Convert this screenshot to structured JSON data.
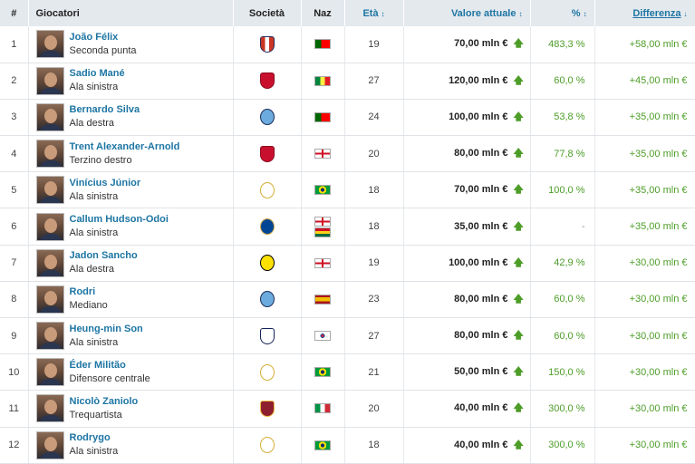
{
  "headers": {
    "rank": "#",
    "players": "Giocatori",
    "club": "Società",
    "nat": "Naz",
    "age": "Età",
    "value": "Valore attuale",
    "pct": "%",
    "diff": "Differenza"
  },
  "sort_icons": {
    "neutral": "↕",
    "active": "↓"
  },
  "arrow_glyph": "🡅",
  "colors": {
    "header_bg": "#e4e9ee",
    "link": "#1d75a3",
    "positive": "#4d9d28"
  },
  "rows": [
    {
      "rank": "1",
      "name": "João Félix",
      "position": "Seconda punta",
      "club": "atletico-madrid-crest",
      "flags": [
        "portugal-flag"
      ],
      "age": "19",
      "value": "70,00 mln €",
      "pct": "483,3 %",
      "diff": "+58,00 mln €"
    },
    {
      "rank": "2",
      "name": "Sadio Mané",
      "position": "Ala sinistra",
      "club": "liverpool-crest",
      "flags": [
        "senegal-flag"
      ],
      "age": "27",
      "value": "120,00 mln €",
      "pct": "60,0 %",
      "diff": "+45,00 mln €"
    },
    {
      "rank": "3",
      "name": "Bernardo Silva",
      "position": "Ala destra",
      "club": "manchester-city-crest",
      "flags": [
        "portugal-flag"
      ],
      "age": "24",
      "value": "100,00 mln €",
      "pct": "53,8 %",
      "diff": "+35,00 mln €"
    },
    {
      "rank": "4",
      "name": "Trent Alexander-Arnold",
      "position": "Terzino destro",
      "club": "liverpool-crest",
      "flags": [
        "england-flag"
      ],
      "age": "20",
      "value": "80,00 mln €",
      "pct": "77,8 %",
      "diff": "+35,00 mln €"
    },
    {
      "rank": "5",
      "name": "Vinícius Júnior",
      "position": "Ala sinistra",
      "club": "real-madrid-crest",
      "flags": [
        "brazil-flag"
      ],
      "age": "18",
      "value": "70,00 mln €",
      "pct": "100,0 %",
      "diff": "+35,00 mln €"
    },
    {
      "rank": "6",
      "name": "Callum Hudson-Odoi",
      "position": "Ala sinistra",
      "club": "chelsea-crest",
      "flags": [
        "england-flag",
        "ghana-flag"
      ],
      "age": "18",
      "value": "35,00 mln €",
      "pct": "-",
      "diff": "+35,00 mln €"
    },
    {
      "rank": "7",
      "name": "Jadon Sancho",
      "position": "Ala destra",
      "club": "borussia-dortmund-crest",
      "flags": [
        "england-flag"
      ],
      "age": "19",
      "value": "100,00 mln €",
      "pct": "42,9 %",
      "diff": "+30,00 mln €"
    },
    {
      "rank": "8",
      "name": "Rodri",
      "position": "Mediano",
      "club": "manchester-city-crest",
      "flags": [
        "spain-flag"
      ],
      "age": "23",
      "value": "80,00 mln €",
      "pct": "60,0 %",
      "diff": "+30,00 mln €"
    },
    {
      "rank": "9",
      "name": "Heung-min Son",
      "position": "Ala sinistra",
      "club": "tottenham-crest",
      "flags": [
        "south-korea-flag"
      ],
      "age": "27",
      "value": "80,00 mln €",
      "pct": "60,0 %",
      "diff": "+30,00 mln €"
    },
    {
      "rank": "10",
      "name": "Éder Militão",
      "position": "Difensore centrale",
      "club": "real-madrid-crest",
      "flags": [
        "brazil-flag"
      ],
      "age": "21",
      "value": "50,00 mln €",
      "pct": "150,0 %",
      "diff": "+30,00 mln €"
    },
    {
      "rank": "11",
      "name": "Nicolò Zaniolo",
      "position": "Trequartista",
      "club": "as-roma-crest",
      "flags": [
        "italy-flag"
      ],
      "age": "20",
      "value": "40,00 mln €",
      "pct": "300,0 %",
      "diff": "+30,00 mln €"
    },
    {
      "rank": "12",
      "name": "Rodrygo",
      "position": "Ala sinistra",
      "club": "real-madrid-crest",
      "flags": [
        "brazil-flag"
      ],
      "age": "18",
      "value": "40,00 mln €",
      "pct": "300,0 %",
      "diff": "+30,00 mln €"
    }
  ]
}
